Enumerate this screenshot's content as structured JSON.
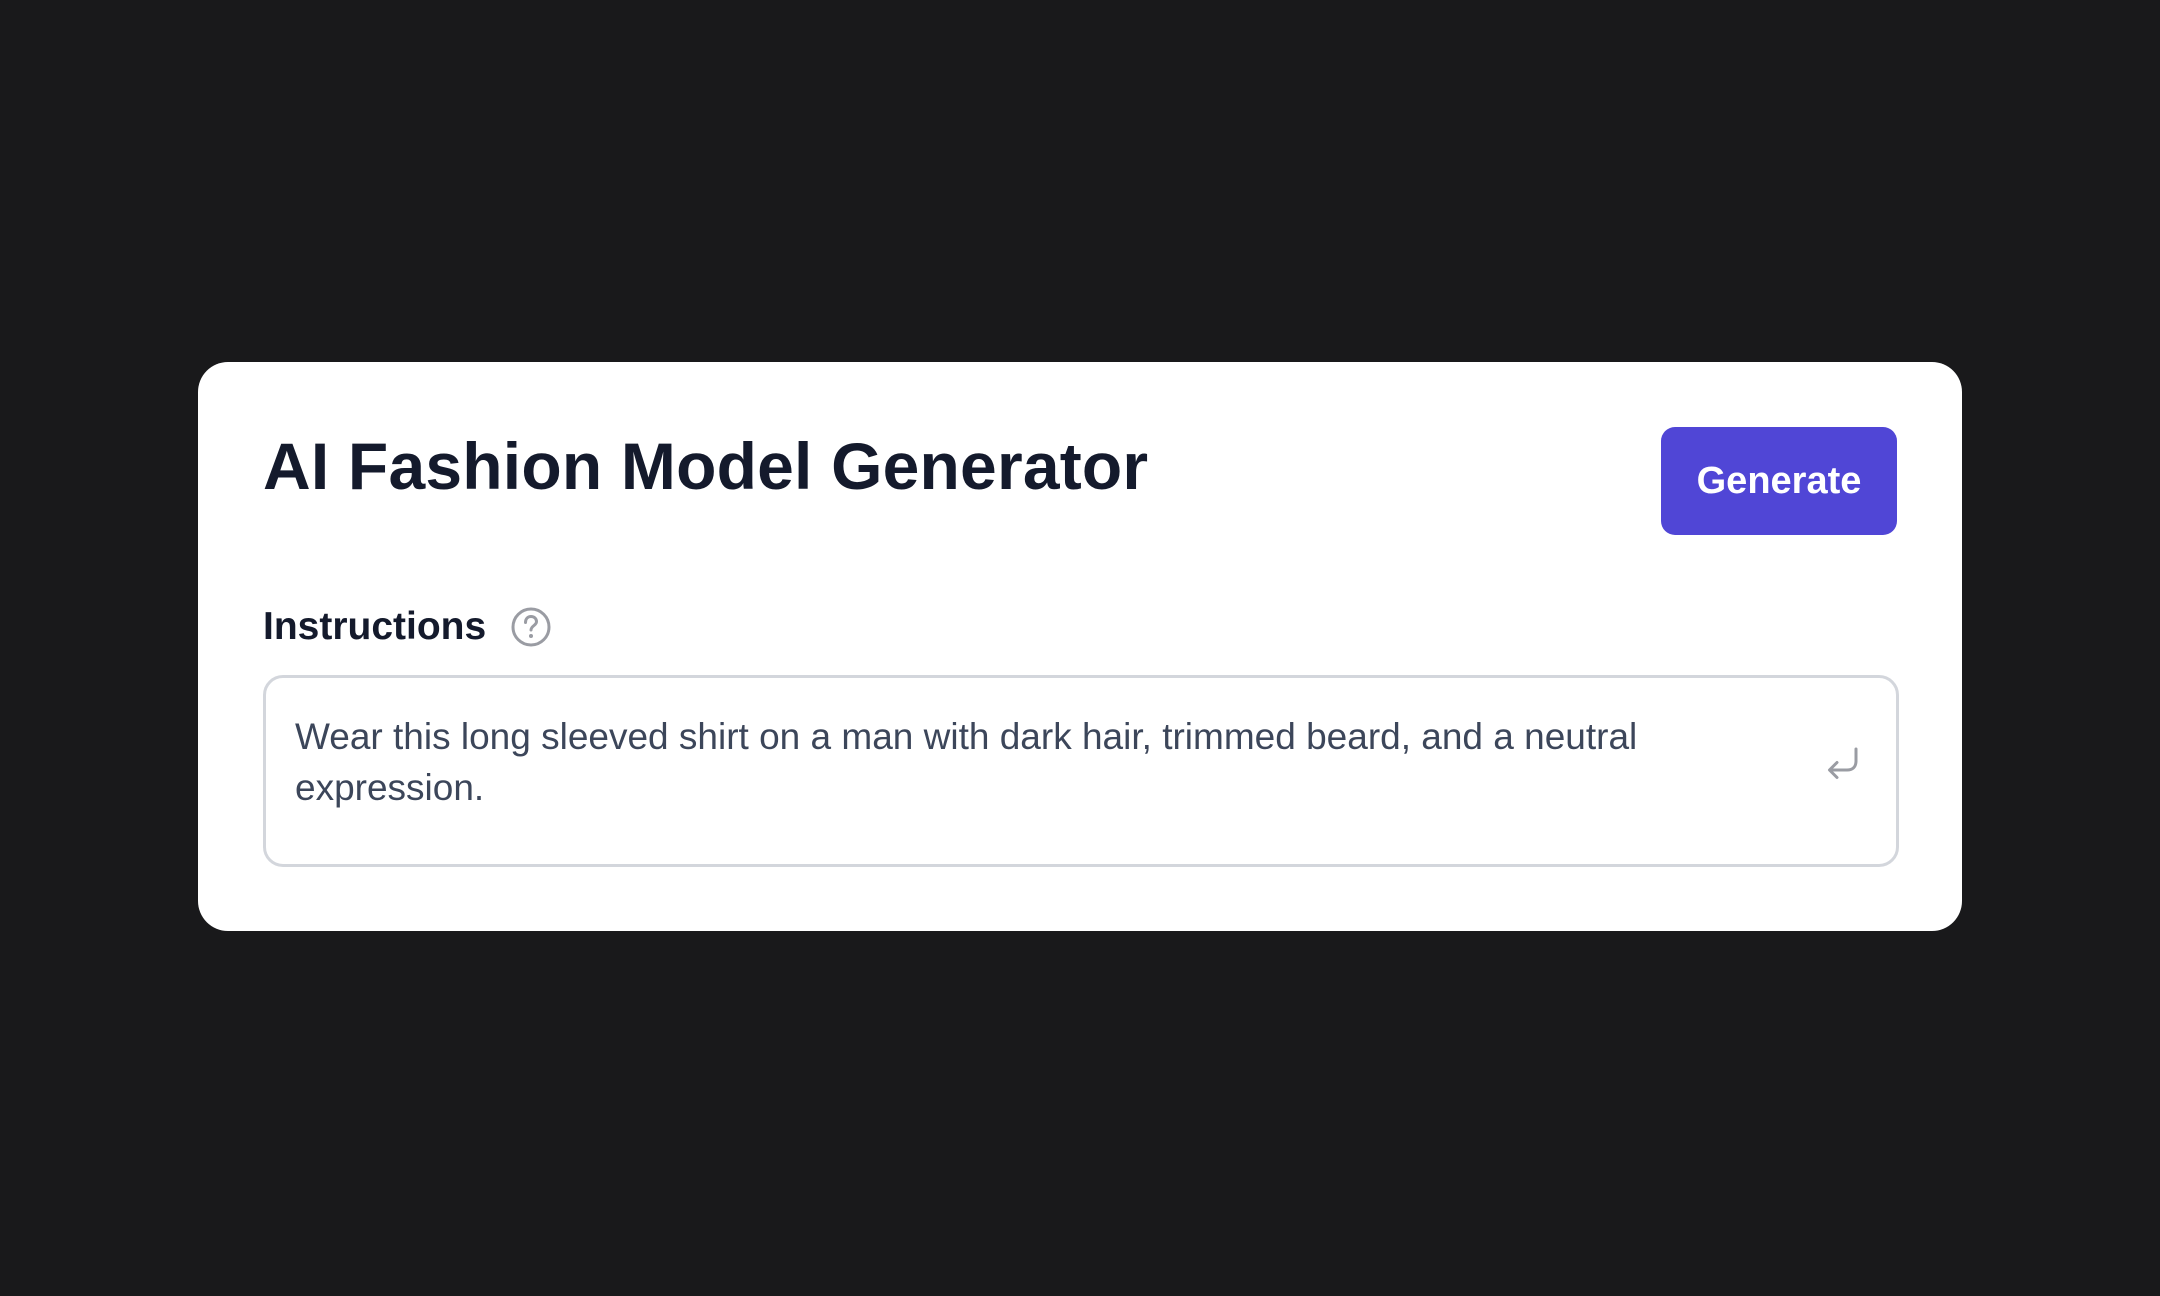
{
  "card": {
    "title": "AI Fashion Model Generator",
    "generate_label": "Generate"
  },
  "instructions": {
    "label": "Instructions",
    "help_icon": "question-circle-icon",
    "value": "Wear this long sleeved shirt on a man with dark hair, trimmed beard, and a neutral expression.",
    "submit_icon": "enter-return-icon"
  },
  "colors": {
    "background": "#19191b",
    "card": "#ffffff",
    "accent": "#5046d6",
    "heading": "#141a2c",
    "body_text": "#3c465a",
    "border": "#d3d6dc",
    "icon": "#9a9ca3"
  }
}
